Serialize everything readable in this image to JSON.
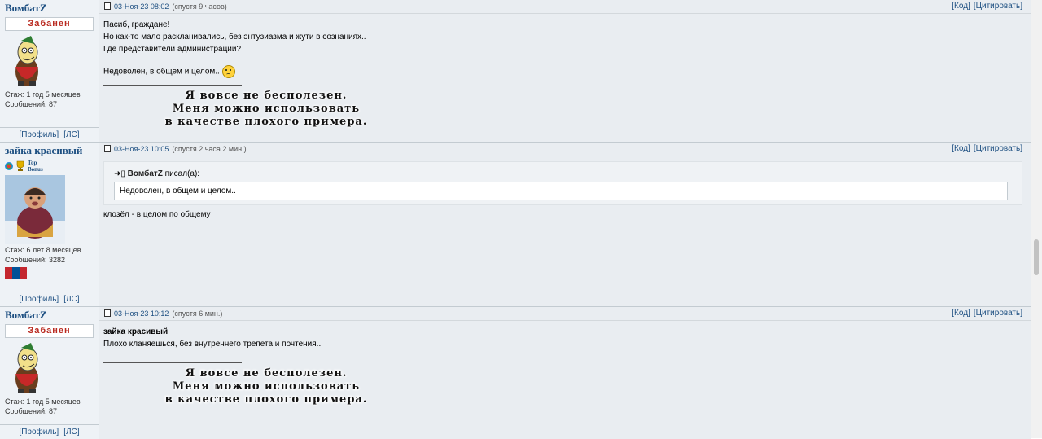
{
  "posts": [
    {
      "user": {
        "name": "ВомбатZ",
        "status": "Забанен",
        "avatar": "cartoon-wombat-avatar",
        "stats": {
          "tenure": "Стаж: 1 год 5 месяцев",
          "posts": "Сообщений: 87"
        },
        "links": [
          "[Профиль]",
          "[ЛС]"
        ]
      },
      "header": {
        "date": "03-Ноя-23 08:02",
        "ago": "(спустя 9 часов)",
        "actions": [
          "[Код]",
          "[Цитировать]"
        ]
      },
      "lines": [
        "Пасиб, граждане!",
        "Но как-то мало раскланивались, без энтузиазма и жути в сознаниях..",
        "Где представители администрации?"
      ],
      "last_line": "Недоволен, в общем и целом..",
      "smiley": "sad-smiley-icon",
      "signature": [
        "Я вовсе не бесполезен.",
        "Меня можно использовать",
        "в качестве плохого примера."
      ]
    },
    {
      "user": {
        "name": "зайка красивый",
        "badge": "Top Bonus",
        "badge_lines": [
          "Top",
          "Bonus"
        ],
        "avatar": "child-in-snow-avatar",
        "stats": {
          "tenure": "Стаж: 6 лет 8 месяцев",
          "posts": "Сообщений: 3282"
        },
        "flag": "mongolia-flag-icon",
        "links": [
          "[Профиль]",
          "[ЛС]"
        ]
      },
      "header": {
        "date": "03-Ноя-23 10:05",
        "ago": "(спустя 2 часа 2 мин.)",
        "actions": [
          "[Код]",
          "[Цитировать]"
        ]
      },
      "quote": {
        "author": "ВомбатZ",
        "wrote": "писал(а):",
        "text": "Недоволен, в общем и целом.."
      },
      "text": "клозёл - в целом по общему"
    },
    {
      "user": {
        "name": "ВомбатZ",
        "status": "Забанен",
        "avatar": "cartoon-wombat-avatar",
        "stats": {
          "tenure": "Стаж: 1 год 5 месяцев",
          "posts": "Сообщений: 87"
        },
        "links": [
          "[Профиль]",
          "[ЛС]"
        ]
      },
      "header": {
        "date": "03-Ноя-23 10:12",
        "ago": "(спустя 6 мин.)",
        "actions": [
          "[Код]",
          "[Цитировать]"
        ]
      },
      "reply_to": "зайка красивый",
      "text": "Плохо кланяешься, без внутреннего трепета и почтения..",
      "signature": [
        "Я вовсе не бесполезен.",
        "Меня можно использовать",
        "в качестве плохого примера."
      ]
    }
  ]
}
